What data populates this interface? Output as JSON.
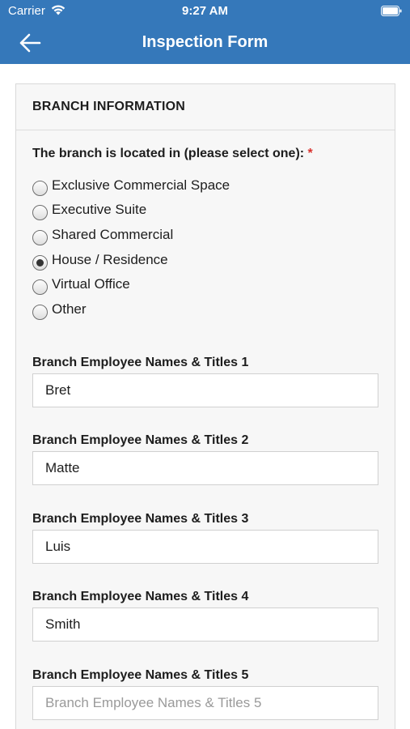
{
  "status_bar": {
    "carrier": "Carrier",
    "time": "9:27 AM"
  },
  "nav": {
    "title": "Inspection Form",
    "back_icon": "arrow-left-icon"
  },
  "section": {
    "title": "BRANCH INFORMATION",
    "question": "The branch is located in (please select one):",
    "required_marker": "*",
    "options": [
      {
        "label": "Exclusive Commercial Space",
        "checked": false
      },
      {
        "label": "Executive Suite",
        "checked": false
      },
      {
        "label": "Shared Commercial",
        "checked": false
      },
      {
        "label": "House / Residence",
        "checked": true
      },
      {
        "label": "Virtual Office",
        "checked": false
      },
      {
        "label": "Other",
        "checked": false
      }
    ],
    "fields": [
      {
        "label": "Branch Employee Names & Titles 1",
        "value": "Bret",
        "placeholder": "Branch Employee Names & Titles 1"
      },
      {
        "label": "Branch Employee Names & Titles 2",
        "value": "Matte",
        "placeholder": "Branch Employee Names & Titles 2"
      },
      {
        "label": "Branch Employee Names & Titles 3",
        "value": "Luis",
        "placeholder": "Branch Employee Names & Titles 3"
      },
      {
        "label": "Branch Employee Names & Titles 4",
        "value": "Smith",
        "placeholder": "Branch Employee Names & Titles 4"
      },
      {
        "label": "Branch Employee Names & Titles 5",
        "value": "",
        "placeholder": "Branch Employee Names & Titles 5"
      }
    ]
  },
  "colors": {
    "header_blue": "#3578ba",
    "required_red": "#d9302c"
  }
}
